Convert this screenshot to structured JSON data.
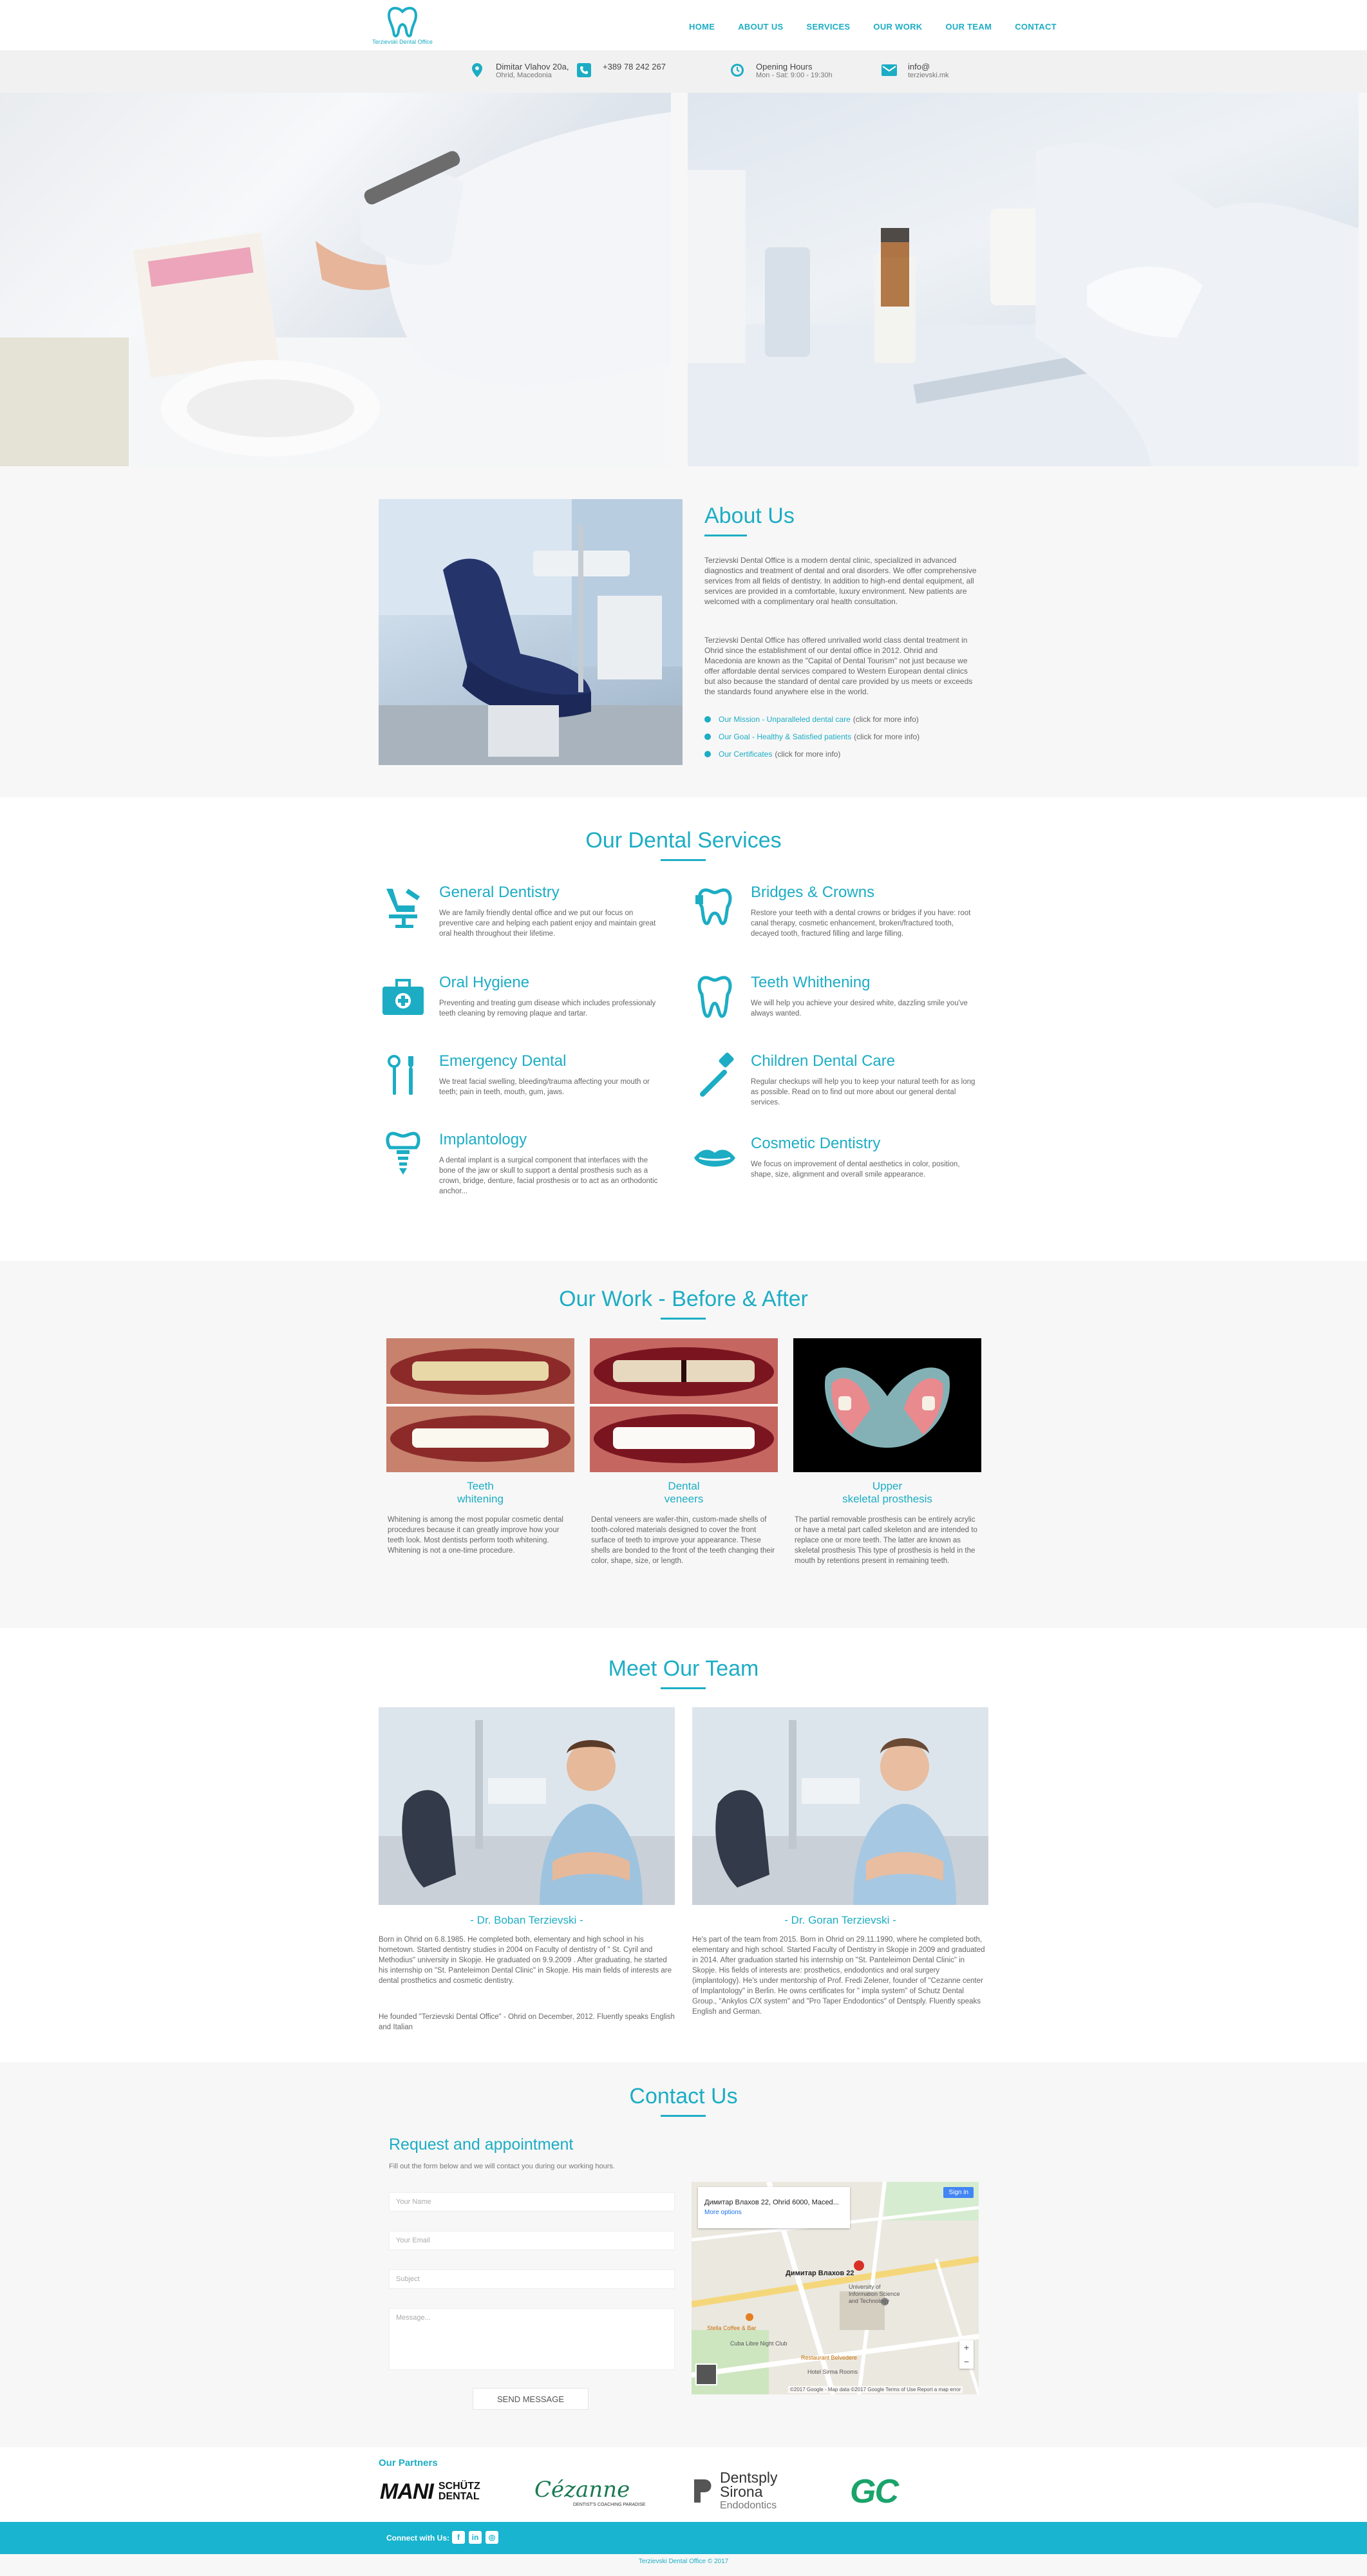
{
  "nav": {
    "logo_text": "Terzievski Dental Office",
    "items": [
      "HOME",
      "ABOUT US",
      "SERVICES",
      "OUR WORK",
      "OUR TEAM",
      "CONTACT"
    ]
  },
  "info": {
    "address": {
      "icon": "map-pin-icon",
      "line1": "Dimitar Vlahov 20a,",
      "line2": "Ohrid, Macedonia"
    },
    "phone": {
      "icon": "phone-icon",
      "line1": "+389 78 242 267"
    },
    "hours": {
      "icon": "clock-icon",
      "line1": "Opening Hours",
      "line2": "Mon - Sat: 9:00 - 19:30h"
    },
    "email": {
      "icon": "envelope-icon",
      "line1": "info@",
      "line2": "terzievski.mk"
    }
  },
  "about": {
    "title": "About Us",
    "p1": "Terzievski Dental Office is a modern dental clinic, specialized in advanced diagnostics and treatment of dental and oral disorders. We offer comprehensive services from all fields of dentistry. In addition to high-end dental equipment, all services are provided in a comfortable, luxury environment. New patients are welcomed with a complimentary oral health consultation.",
    "p2": "Terzievski Dental Office has offered unrivalled world class dental treatment in Ohrid since the establishment of our dental office in 2012. Ohrid and Macedonia are known as the \"Capital of Dental Tourism\" not just because we offer affordable dental services compared to Western European dental clinics but also because the standard of dental care provided by us meets or exceeds the standards found anywhere else in the world.",
    "bullets": [
      {
        "link": "Our Mission - Unparalleled dental care",
        "hint": "(click for more info)"
      },
      {
        "link": "Our Goal - Healthy & Satisfied patients",
        "hint": "(click for more info)"
      },
      {
        "link": "Our Certificates",
        "hint": "(click for more info)"
      }
    ]
  },
  "services": {
    "title": "Our Dental Services",
    "items": [
      {
        "icon": "dental-chair-icon",
        "title": "General Dentistry",
        "text": "We are family friendly dental office and we put our focus on preventive care and helping each patient enjoy and maintain great oral health throughout their lifetime."
      },
      {
        "icon": "tooth-bridge-icon",
        "title": "Bridges & Crowns",
        "text": "Restore your teeth with a dental crowns or bridges if you have: root canal therapy, cosmetic enhancement, broken/fractured tooth, decayed tooth, fractured filling and large filling."
      },
      {
        "icon": "first-aid-kit-icon",
        "title": "Oral Hygiene",
        "text": "Preventing and treating gum disease which includes professionaly teeth cleaning by removing plaque and tartar."
      },
      {
        "icon": "tooth-icon",
        "title": "Teeth Whithening",
        "text": "We will help you achieve your desired white, dazzling smile you've always wanted."
      },
      {
        "icon": "dental-tools-icon",
        "title": "Emergency Dental",
        "text": "We treat facial swelling, bleeding/trauma affecting your mouth or teeth; pain in teeth, mouth, gum, jaws."
      },
      {
        "icon": "toothbrush-icon",
        "title": "Children Dental Care",
        "text": "Regular checkups will help you to keep your natural teeth for as long as possible. Read on to find out more about our general dental services."
      },
      {
        "icon": "implant-icon",
        "title": "Implantology",
        "text": "A dental implant is a surgical component that interfaces with the bone of the jaw or skull to support a dental prosthesis such as a crown, bridge, denture, facial prosthesis or to act as an orthodontic anchor..."
      },
      {
        "icon": "lips-icon",
        "title": "Cosmetic Dentistry",
        "text": "We focus on improvement of dental aesthetics in color, position, shape, size, alignment and overall smile appearance."
      }
    ]
  },
  "work": {
    "title": "Our Work - Before & After",
    "items": [
      {
        "cap1": "Teeth",
        "cap2": "whitening",
        "text": "Whitening is among the most popular cosmetic dental procedures because it can greatly improve how your teeth look. Most dentists perform tooth whitening. Whitening is not a one-time procedure."
      },
      {
        "cap1": "Dental",
        "cap2": "veneers",
        "text": "Dental veneers are wafer-thin, custom-made shells of tooth-colored materials designed to cover the front surface of teeth to improve your appearance. These shells are bonded to the front of the teeth changing their color, shape, size, or length."
      },
      {
        "cap1": "Upper",
        "cap2": "skeletal prosthesis",
        "text": "The partial removable prosthesis can be entirely acrylic or have a metal part called skeleton and are intended to replace one or more teeth. The latter are known as skeletal prosthesis This type of prosthesis is held in the mouth by retentions present in remaining teeth."
      }
    ]
  },
  "team": {
    "title": "Meet Our Team",
    "members": [
      {
        "name": "- Dr. Boban Terzievski -",
        "p1": "Born in Ohrid on 6.8.1985. He completed both, elementary and high school in his hometown. Started dentistry studies in 2004 on Faculty of dentistry of \" St. Cyril and Methodius\" university in Skopje. He graduated on 9.9.2009 . After graduating, he started his internship on \"St. Panteleimon Dental Clinic\" in Skopje. His main fields of interests are dental prosthetics and cosmetic dentistry.",
        "p2": "He founded \"Terzievski Dental Office\" - Ohrid on December, 2012. Fluently speaks English and Italian"
      },
      {
        "name": "- Dr. Goran Terzievski -",
        "p1": "He's part of the team from 2015. Born in Ohrid on 29.11.1990, where he completed both, elementary and high school. Started Faculty of Dentistry in Skopje in 2009 and graduated in 2014. After graduation started his internship on \"St. Panteleimon Dental Clinic\" in Skopje. His fields of interests are: prosthetics, endodontics and oral surgery (implantology). He's under mentorship of Prof. Fredi Zelener, founder of \"Cezanne center of Implantology\" in Berlin. He owns certificates for \" impla system\" of Schutz Dental Group., \"Ankylos C/X system\" and \"Pro Taper Endodontics\" of Dentsply. Fluently speaks English and German."
      }
    ]
  },
  "contact": {
    "title": "Contact Us",
    "subtitle": "Request and appointment",
    "note": "Fill out the form below and we will contact you during our working hours.",
    "name_ph": "Your Name",
    "email_ph": "Your Email",
    "subject_ph": "Subject",
    "message_ph": "Message...",
    "send": "SEND MESSAGE",
    "map": {
      "place": "Димитар Влахов 22, Ohrid 6000, Maced...",
      "more": "More options",
      "sign_in": "Sign in",
      "pin_label": "Димитар Влахов 22",
      "poi1": "University of Information Science and Technology",
      "poi2": "Stella Coffee & Bar",
      "poi3": "Cuba Libre Night Club",
      "poi4": "Restaurant Belvedere",
      "poi5": "Hotel Sirma Rooms",
      "footer": "©2017 Google - Map data ©2017 Google  Terms of Use  Report a map error"
    }
  },
  "partners": {
    "title": "Our Partners",
    "logos": [
      "MANI",
      "SCHÜTZ DENTAL",
      "Cézanne",
      "DENTIST'S COACHING PARADISE",
      "Dentsply",
      "Sirona",
      "Endodontics",
      "GC"
    ]
  },
  "footer": {
    "connect": "Connect with Us:",
    "social": [
      "f",
      "in",
      "◎"
    ],
    "copyright": "Terzievski Dental Office © 2017"
  },
  "colors": {
    "accent": "#1cadc4",
    "footer": "#19b4cf"
  }
}
